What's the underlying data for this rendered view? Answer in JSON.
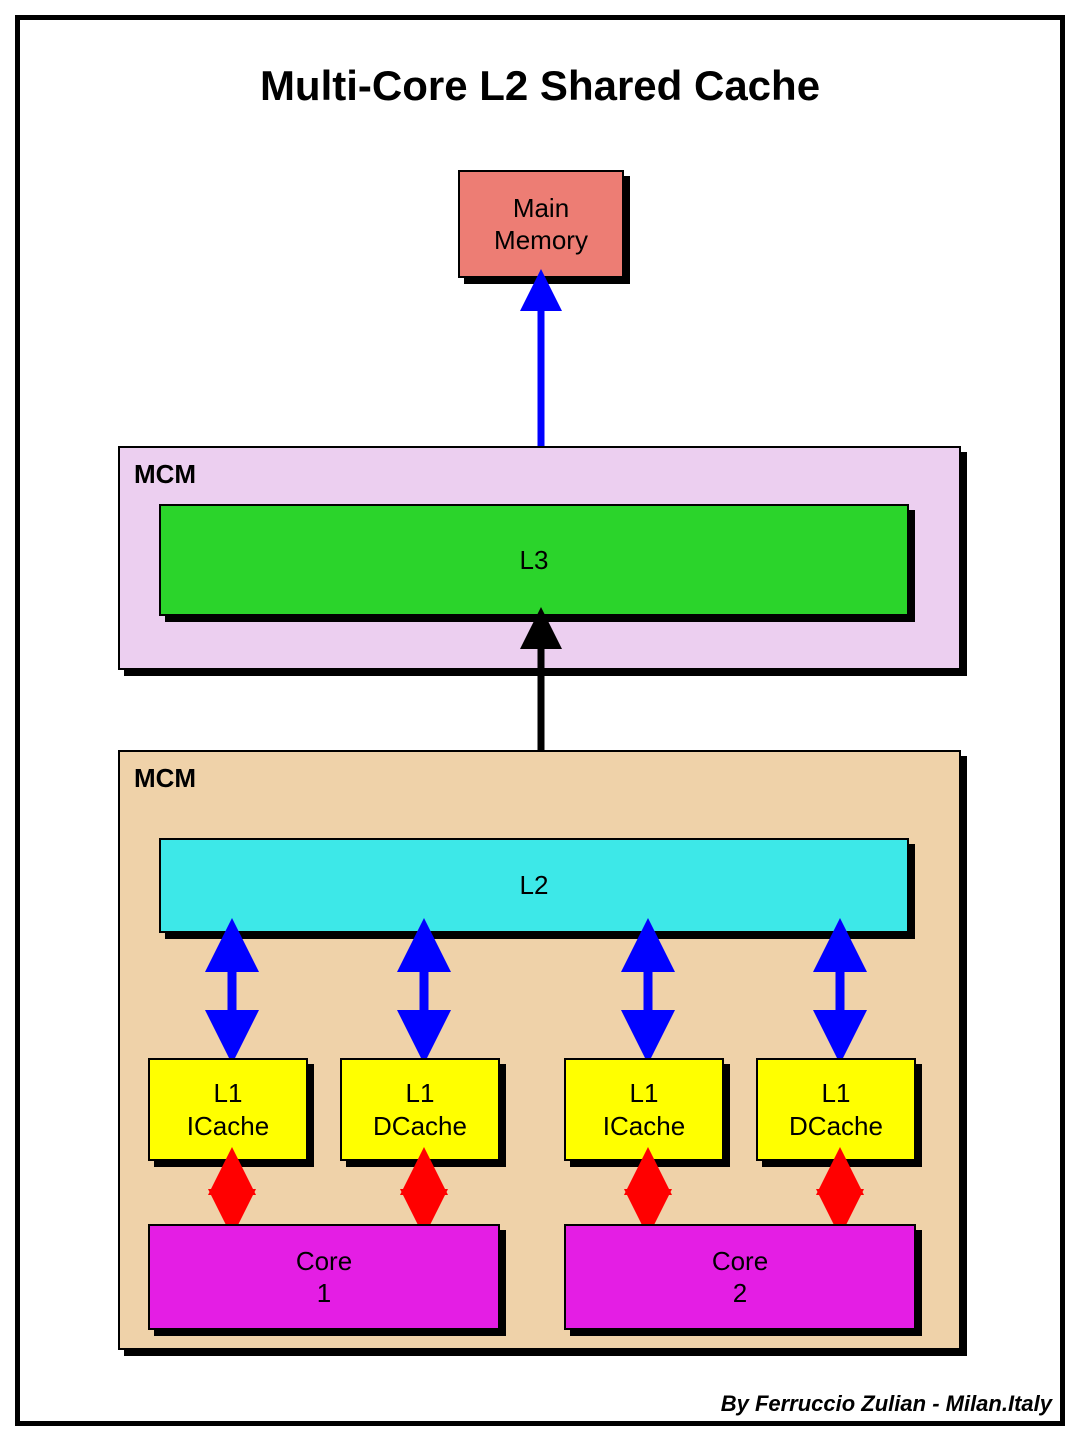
{
  "title": "Multi-Core L2 Shared Cache",
  "main_memory": "Main Memory",
  "mcm_upper_label": "MCM",
  "l3": "L3",
  "mcm_lower_label": "MCM",
  "l2": "L2",
  "l1": {
    "icache1": "L1 ICache",
    "dcache1": "L1 DCache",
    "icache2": "L1 ICache",
    "dcache2": "L1 DCache"
  },
  "core1": "Core 1",
  "core2": "Core 2",
  "credit": "By Ferruccio Zulian - Milan.Italy",
  "colors": {
    "main_memory": "#ed7d74",
    "mcm_upper": "#eccff0",
    "l3": "#2bd42b",
    "mcm_lower": "#efd2a9",
    "l2": "#3de8e8",
    "l1": "#ffff00",
    "core": "#e41ee4",
    "arrow_blue": "#0000ff",
    "arrow_black": "#000000",
    "arrow_red": "#ff0000"
  }
}
